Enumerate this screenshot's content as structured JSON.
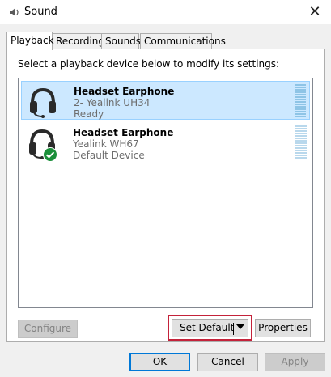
{
  "window": {
    "title": "Sound",
    "close_glyph": "✕"
  },
  "tabs": [
    {
      "label": "Playback"
    },
    {
      "label": "Recording"
    },
    {
      "label": "Sounds"
    },
    {
      "label": "Communications"
    }
  ],
  "playback": {
    "instructions": "Select a playback device below to modify its settings:",
    "devices": [
      {
        "name": "Headset Earphone",
        "description": "2- Yealink UH34",
        "status": "Ready",
        "selected": true,
        "icon": "headset-icon"
      },
      {
        "name": "Headset Earphone",
        "description": "Yealink WH67",
        "status": "Default Device",
        "selected": false,
        "icon": "headset-icon",
        "badge": "default-check-icon"
      }
    ]
  },
  "buttons": {
    "configure": "Configure",
    "set_default": "Set Default",
    "properties": "Properties",
    "ok": "OK",
    "cancel": "Cancel",
    "apply": "Apply"
  },
  "colors": {
    "selection": "#cce8ff",
    "selection_border": "#99d1ff",
    "highlight": "#c4223a",
    "default_badge": "#1b8f3a",
    "focus_border": "#0078d7"
  }
}
